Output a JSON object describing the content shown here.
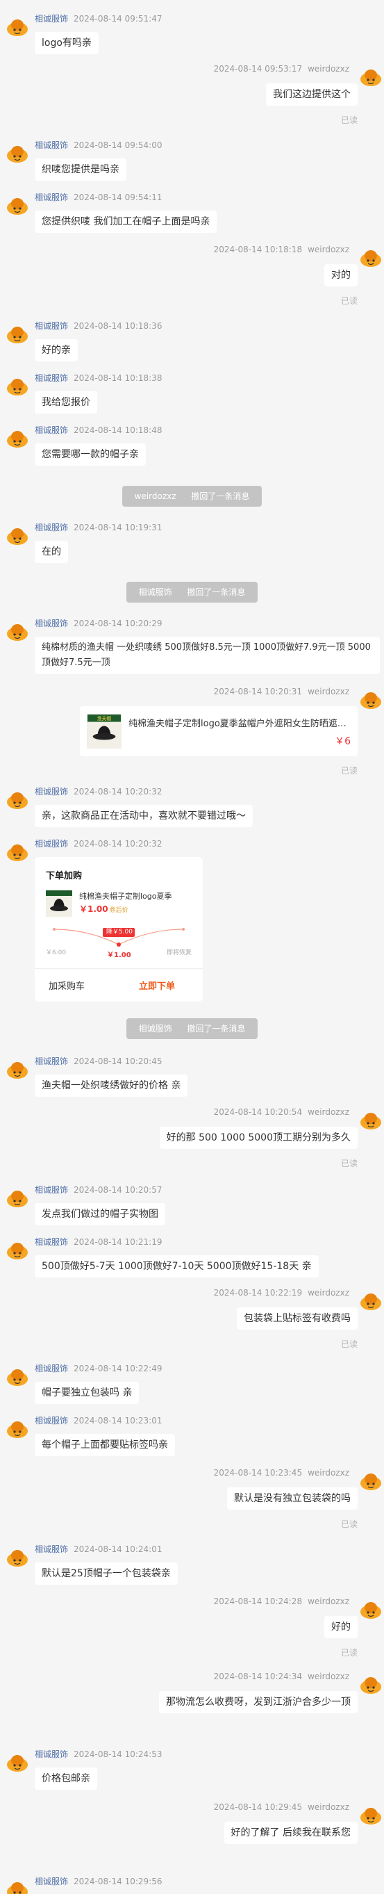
{
  "shop_name": "相诚服饰",
  "customer_name": "weirdozxz",
  "read_label": "已读",
  "recall_text": "撤回了一条消息",
  "colors": {
    "sender": "#4e6ea8",
    "price": "#e33333",
    "buy": "#f05a1a",
    "recall_bg": "#c4c4c4"
  },
  "messages": [
    {
      "time": "2024-08-14 09:51:47",
      "text": "logo有吗亲"
    },
    {
      "time": "2024-08-14 09:53:17",
      "text": "我们这边提供这个"
    },
    {
      "time": "2024-08-14 09:54:00",
      "text": "织唛您提供是吗亲"
    },
    {
      "time": "2024-08-14 09:54:11",
      "text": "您提供织唛  我们加工在帽子上面是吗亲"
    },
    {
      "time": "2024-08-14 10:18:18",
      "text": "对的"
    },
    {
      "time": "2024-08-14 10:18:36",
      "text": "好的亲"
    },
    {
      "time": "2024-08-14 10:18:38",
      "text": "我给您报价"
    },
    {
      "time": "2024-08-14 10:18:48",
      "text": "您需要哪一款的帽子亲"
    },
    {
      "time": "2024-08-14 10:19:31",
      "text": "在的"
    },
    {
      "time": "2024-08-14 10:20:29",
      "text": "纯棉材质的渔夫帽 一处织唛绣 500顶做好8.5元一顶   1000顶做好7.9元一顶 5000顶做好7.5元一顶"
    },
    {
      "time": "2024-08-14 10:20:31"
    },
    {
      "time": "2024-08-14 10:20:32",
      "text": "亲，这款商品正在活动中，喜欢就不要错过哦～"
    },
    {
      "time": "2024-08-14 10:20:32"
    },
    {
      "time": "2024-08-14 10:20:45",
      "text": "渔夫帽一处织唛绣做好的价格  亲"
    },
    {
      "time": "2024-08-14 10:20:54",
      "text": "好的那 500 1000 5000顶工期分别为多久"
    },
    {
      "time": "2024-08-14 10:20:57",
      "text": "发点我们做过的帽子实物图"
    },
    {
      "time": "2024-08-14 10:21:19",
      "text": "500顶做好5-7天    1000顶做好7-10天  5000顶做好15-18天 亲"
    },
    {
      "time": "2024-08-14 10:22:19",
      "text": "包装袋上贴标签有收费吗"
    },
    {
      "time": "2024-08-14 10:22:49",
      "text": "帽子要独立包装吗 亲"
    },
    {
      "time": "2024-08-14 10:23:01",
      "text": "每个帽子上面都要贴标签吗亲"
    },
    {
      "time": "2024-08-14 10:23:45",
      "text": "默认是没有独立包装袋的吗"
    },
    {
      "time": "2024-08-14 10:24:01",
      "text": "默认是25顶帽子一个包装袋亲"
    },
    {
      "time": "2024-08-14 10:24:28",
      "text": "好的"
    },
    {
      "time": "2024-08-14 10:24:34",
      "text": "那物流怎么收费呀，发到江浙沪合多少一顶"
    },
    {
      "time": "2024-08-14 10:24:53",
      "text": "价格包邮亲"
    },
    {
      "time": "2024-08-14 10:29:45",
      "text": "好的了解了 后续我在联系您"
    },
    {
      "time": "2024-08-14 10:29:56"
    }
  ],
  "product_card": {
    "title": "纯棉渔夫帽子定制logo夏季盆帽户外遮阳女生防晒遮阳...",
    "price": "￥6",
    "thumb_text": "渔夫帽"
  },
  "order_card": {
    "header": "下单加购",
    "title": "纯棉渔夫帽子定制logo夏季",
    "price": "￥1.00",
    "price_tag": "券后价",
    "tier_left": "￥6.00",
    "tier_mid_badge": "降￥5.00",
    "tier_mid": "￥1.00",
    "tier_right": "即将恢复",
    "btn_cart": "加采购车",
    "btn_buy": "立即下单"
  }
}
